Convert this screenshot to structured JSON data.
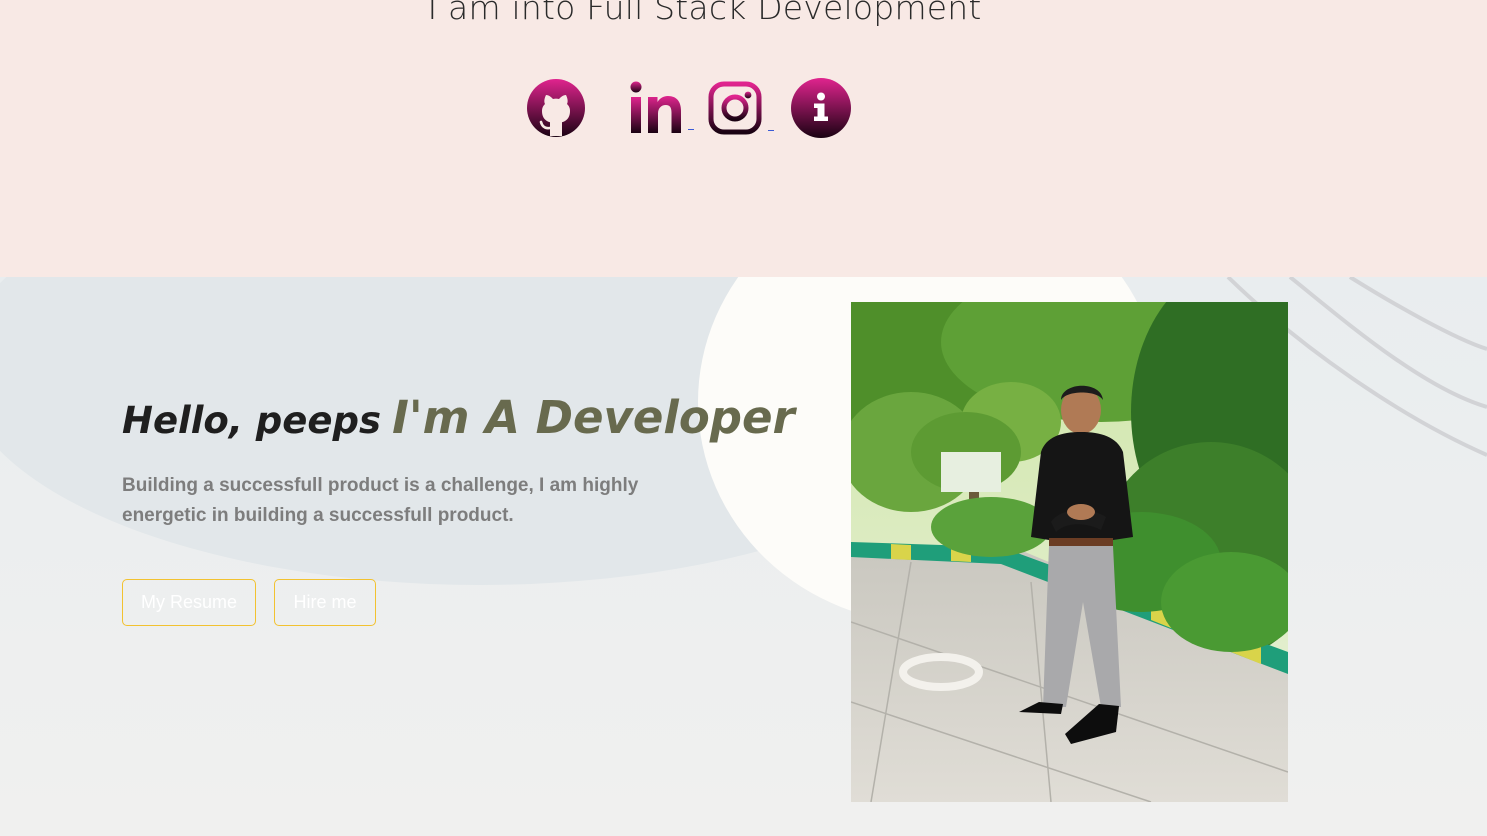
{
  "tagline": "I am into Full Stack Development",
  "socials": [
    {
      "name": "GitHub",
      "icon": "github-icon"
    },
    {
      "name": "LinkedIn",
      "icon": "linkedin-icon"
    },
    {
      "name": "Instagram",
      "icon": "instagram-icon"
    },
    {
      "name": "Info",
      "icon": "info-icon"
    }
  ],
  "hero": {
    "greeting": "Hello, peeps",
    "headline": "I'm A Developer",
    "description": "Building a successfull product is a challenge, I am highly energetic in building a successfull product.",
    "buttons": {
      "resume": "My Resume",
      "hire": "Hire me"
    },
    "photo": {
      "subject": "developer-portrait-photo"
    }
  },
  "colors": {
    "top_background": "#f8e9e5",
    "hero_background": "#f0f0ef",
    "icon_gradient_start": "#e0248e",
    "icon_gradient_end": "#1a0212",
    "button_border": "#f2c230",
    "headline_accent": "#686a4e"
  }
}
